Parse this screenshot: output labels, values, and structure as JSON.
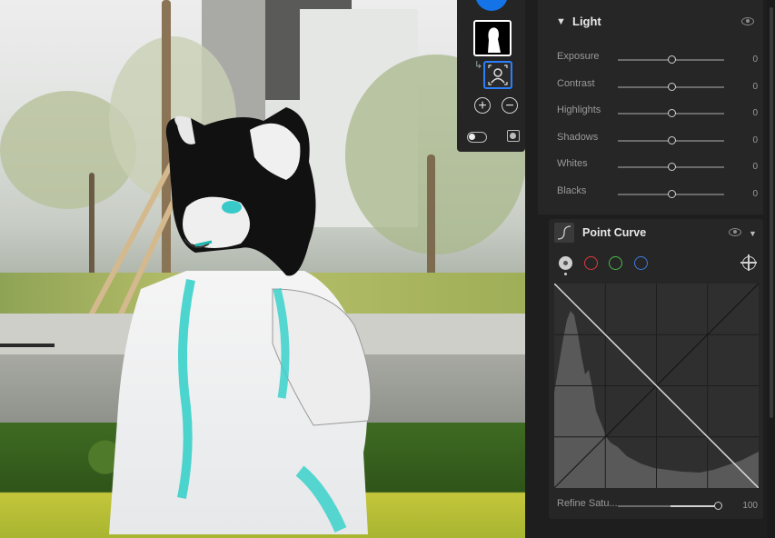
{
  "mask_panel": {
    "add_icon": "plus-circle-icon",
    "remove_icon": "minus-circle-icon",
    "toggle_icon": "toggle-switch-icon",
    "overlay_icon": "overlay-square-icon"
  },
  "light": {
    "title": "Light",
    "sliders": [
      {
        "label": "Exposure",
        "value": "0",
        "position": 0.5
      },
      {
        "label": "Contrast",
        "value": "0",
        "position": 0.5
      },
      {
        "label": "Highlights",
        "value": "0",
        "position": 0.5
      },
      {
        "label": "Shadows",
        "value": "0",
        "position": 0.5
      },
      {
        "label": "Whites",
        "value": "0",
        "position": 0.5
      },
      {
        "label": "Blacks",
        "value": "0",
        "position": 0.5
      }
    ]
  },
  "point_curve": {
    "title": "Point Curve",
    "channels": [
      "rgb",
      "red",
      "green",
      "blue"
    ],
    "channel_colors": {
      "red": "#e03a3a",
      "green": "#4ab84a",
      "blue": "#3b7be0"
    },
    "refine_label": "Refine Satu...",
    "refine_value": "100",
    "refine_position": 1.0
  },
  "colors": {
    "accent": "#1473e6",
    "panel_bg": "#262626"
  }
}
